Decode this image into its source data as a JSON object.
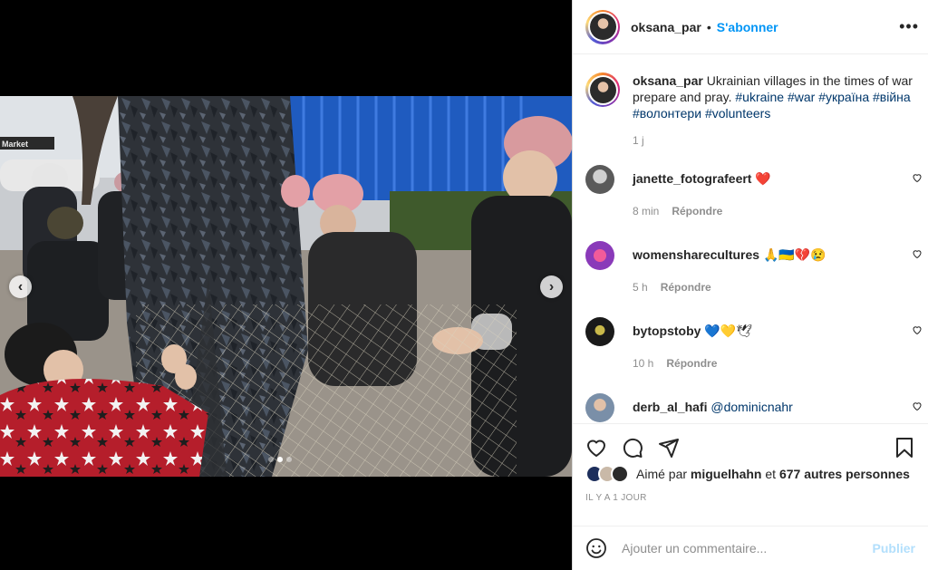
{
  "post": {
    "author": "oksana_par",
    "separator": "•",
    "follow_label": "S'abonner",
    "more_label": "•••",
    "caption": {
      "username": "oksana_par",
      "text": "Ukrainian villages in the times of war prepare and pray.",
      "hashtags": [
        "#ukraine",
        "#war",
        "#україна",
        "#війна",
        "#волонтери",
        "#volunteers"
      ],
      "time": "1 j"
    },
    "media": {
      "icons": {
        "prev": "chevron-left-icon",
        "next": "chevron-right-icon"
      },
      "prev_glyph": "‹",
      "next_glyph": "›",
      "carousel_count": 3,
      "carousel_active": 2
    }
  },
  "comments": [
    {
      "username": "janette_fotografeert",
      "text": "❤️",
      "time": "8 min",
      "reply_label": "Répondre",
      "avatar_color": "#5a5a5a"
    },
    {
      "username": "womensharecultures",
      "text": "🙏🇺🇦💔😢",
      "time": "5 h",
      "reply_label": "Répondre",
      "avatar_color": "#8a3ab9"
    },
    {
      "username": "bytopstoby",
      "text": "💙💛🕊",
      "time": "10 h",
      "reply_label": "Répondre",
      "avatar_color": "#1a1a1a"
    },
    {
      "username": "derb_al_hafi",
      "text": "@dominicnahr",
      "time": "",
      "reply_label": "",
      "avatar_color": "#7a8fa8"
    }
  ],
  "actions": {
    "icons": [
      "heart-icon",
      "comment-icon",
      "share-icon",
      "bookmark-icon"
    ],
    "likes_prefix": "Aimé par",
    "likes_user": "miguelhahn",
    "likes_conj": "et",
    "likes_others": "677 autres personnes",
    "date": "IL Y A 1 JOUR"
  },
  "add_comment": {
    "placeholder": "Ajouter un commentaire...",
    "publish_label": "Publier"
  },
  "colors": {
    "accent": "#0095f6",
    "hashtag": "#00376b",
    "publish_disabled": "#b2dffc"
  }
}
